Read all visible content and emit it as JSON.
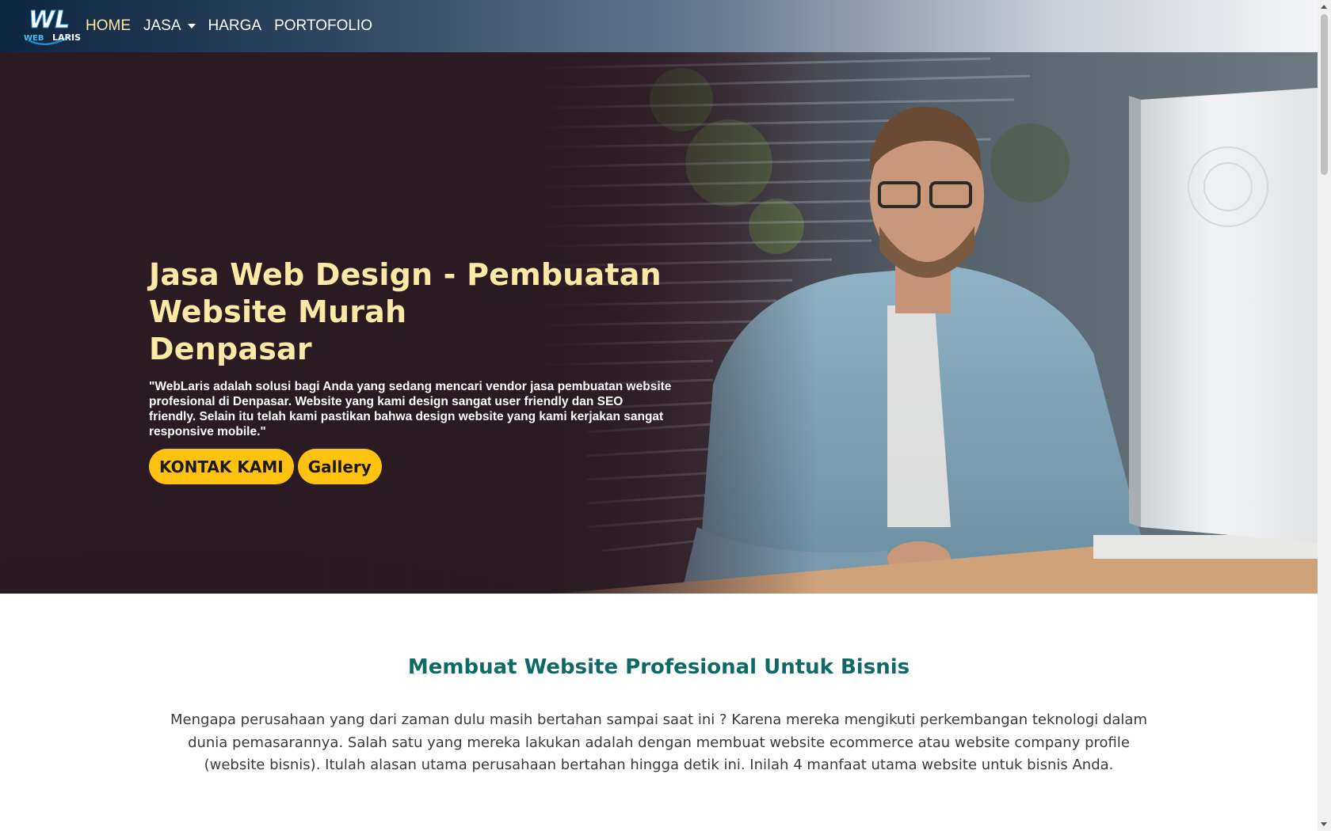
{
  "navbar": {
    "logo_text_top": "WL",
    "logo_text_bottom_left": "WEB",
    "logo_text_bottom_right": "LARIS",
    "links": [
      {
        "label": "HOME",
        "active": true
      },
      {
        "label": "JASA",
        "dropdown": true
      },
      {
        "label": "HARGA"
      },
      {
        "label": "PORTOFOLIO"
      }
    ]
  },
  "hero": {
    "title_lines": [
      "Jasa Web Design - Pembuatan",
      "Website Murah",
      "Denpasar"
    ],
    "description": "\"WebLaris adalah solusi bagi Anda yang sedang mencari vendor jasa pembuatan website profesional di Denpasar. Website yang kami design sangat user friendly dan SEO friendly. Selain itu telah kami pastikan bahwa design website yang kami kerjakan sangat responsive mobile.\"",
    "buttons": {
      "contact": "KONTAK KAMI",
      "gallery": "Gallery"
    }
  },
  "section": {
    "title": "Membuat Website Profesional Untuk Bisnis",
    "text": "Mengapa perusahaan yang dari zaman dulu masih bertahan sampai saat ini ? Karena mereka mengikuti perkembangan teknologi dalam dunia pemasarannya. Salah satu yang mereka lakukan adalah dengan membuat website ecommerce atau website company profile (website bisnis). Itulah alasan utama perusahaan bertahan hingga detik ini. Inilah 4 manfaat utama website untuk bisnis Anda."
  },
  "colors": {
    "accent_yellow": "#ffc20e",
    "title_cream": "#fde9a6",
    "section_teal": "#0f6a66"
  }
}
